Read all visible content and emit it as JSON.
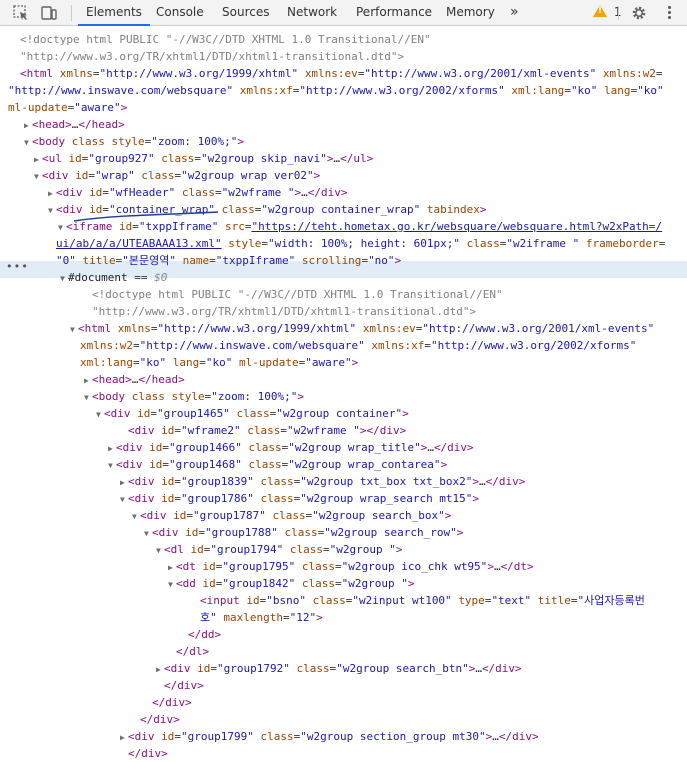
{
  "toolbar": {
    "tabs": [
      "Elements",
      "Console",
      "Sources",
      "Network",
      "Performance",
      "Memory"
    ],
    "active_tab": "Elements",
    "overflow": "»",
    "warning_count": "1"
  },
  "colors": {
    "accent": "#1a73e8",
    "tag": "#881280",
    "attr_name": "#994500",
    "attr_value": "#1a1aa6",
    "selected": "#e1ecf7"
  },
  "lines": [
    {
      "ind": 20,
      "tri": "",
      "segs": [
        [
          "cm",
          "<!doctype html PUBLIC \"-//W3C//DTD XHTML 1.0 Transitional//EN\""
        ]
      ]
    },
    {
      "ind": 20,
      "tri": "",
      "segs": [
        [
          "cm",
          "\"http://www.w3.org/TR/xhtml1/DTD/xhtml1-transitional.dtd\">"
        ]
      ]
    },
    {
      "ind": 20,
      "tri": "",
      "segs": [
        [
          "tag",
          "<html "
        ],
        [
          "an",
          "xmlns"
        ],
        [
          "eq",
          "="
        ],
        [
          "av",
          "\"http://www.w3.org/1999/xhtml\" "
        ],
        [
          "an",
          "xmlns:ev"
        ],
        [
          "eq",
          "="
        ],
        [
          "av",
          "\"http://www.w3.org/2001/xml-events\" "
        ],
        [
          "an",
          "xmlns:w2"
        ],
        [
          "eq",
          "="
        ]
      ]
    },
    {
      "ind": 8,
      "tri": "",
      "segs": [
        [
          "av",
          "\"http://www.inswave.com/websquare\" "
        ],
        [
          "an",
          "xmlns:xf"
        ],
        [
          "eq",
          "="
        ],
        [
          "av",
          "\"http://www.w3.org/2002/xforms\" "
        ],
        [
          "an",
          "xml:lang"
        ],
        [
          "eq",
          "="
        ],
        [
          "av",
          "\"ko\" "
        ],
        [
          "an",
          "lang"
        ],
        [
          "eq",
          "="
        ],
        [
          "av",
          "\"ko\""
        ]
      ]
    },
    {
      "ind": 8,
      "tri": "",
      "segs": [
        [
          "an",
          "ml-update"
        ],
        [
          "eq",
          "="
        ],
        [
          "av",
          "\"aware\""
        ],
        [
          "tag",
          ">"
        ]
      ]
    },
    {
      "ind": 34,
      "tri": "▶",
      "segs": [
        [
          "tag",
          "<head>"
        ],
        [
          "tx",
          "…"
        ],
        [
          "tag",
          "</head>"
        ]
      ]
    },
    {
      "ind": 34,
      "tri": "▼",
      "segs": [
        [
          "tag",
          "<body "
        ],
        [
          "an",
          "class "
        ],
        [
          "an",
          "style"
        ],
        [
          "eq",
          "="
        ],
        [
          "av",
          "\"zoom: 100%;\""
        ],
        [
          "tag",
          ">"
        ]
      ]
    },
    {
      "ind": 44,
      "tri": "▶",
      "segs": [
        [
          "tag",
          "<ul "
        ],
        [
          "an",
          "id"
        ],
        [
          "eq",
          "="
        ],
        [
          "av",
          "\"group927\" "
        ],
        [
          "an",
          "class"
        ],
        [
          "eq",
          "="
        ],
        [
          "av",
          "\"w2group skip_navi\""
        ],
        [
          "tag",
          ">"
        ],
        [
          "tx",
          "…"
        ],
        [
          "tag",
          "</ul>"
        ]
      ]
    },
    {
      "ind": 44,
      "tri": "▼",
      "segs": [
        [
          "tag",
          "<div "
        ],
        [
          "an",
          "id"
        ],
        [
          "eq",
          "="
        ],
        [
          "av",
          "\"wrap\" "
        ],
        [
          "an",
          "class"
        ],
        [
          "eq",
          "="
        ],
        [
          "av",
          "\"w2group wrap ver02\""
        ],
        [
          "tag",
          ">"
        ]
      ]
    },
    {
      "ind": 58,
      "tri": "▶",
      "segs": [
        [
          "tag",
          "<div "
        ],
        [
          "an",
          "id"
        ],
        [
          "eq",
          "="
        ],
        [
          "av",
          "\"wfHeader\" "
        ],
        [
          "an",
          "class"
        ],
        [
          "eq",
          "="
        ],
        [
          "av",
          "\"w2wframe \""
        ],
        [
          "tag",
          ">"
        ],
        [
          "tx",
          "…"
        ],
        [
          "tag",
          "</div>"
        ]
      ]
    },
    {
      "ind": 58,
      "tri": "▼",
      "segs": [
        [
          "tag",
          "<div "
        ],
        [
          "an",
          "id"
        ],
        [
          "eq",
          "="
        ],
        [
          "av",
          "\"container_wrap\" "
        ],
        [
          "an",
          "class"
        ],
        [
          "eq",
          "="
        ],
        [
          "av",
          "\"w2group container_wrap\" "
        ],
        [
          "an",
          "tabindex"
        ],
        [
          "tag",
          ">"
        ]
      ]
    },
    {
      "ind": 68,
      "tri": "▼",
      "segs": [
        [
          "tag",
          "<iframe "
        ],
        [
          "an",
          "id"
        ],
        [
          "eq",
          "="
        ],
        [
          "av",
          "\"txppIframe\" "
        ],
        [
          "an",
          "src"
        ],
        [
          "eq",
          "="
        ],
        [
          "ln",
          "\"https://teht.hometax.go.kr/websquare/websquare.html?w2xPath=/"
        ]
      ]
    },
    {
      "ind": 56,
      "tri": "",
      "segs": [
        [
          "ln",
          "ui/ab/a/a/UTEABAAA13.xml\""
        ],
        [
          "tx",
          " "
        ],
        [
          "an",
          "style"
        ],
        [
          "eq",
          "="
        ],
        [
          "av",
          "\"width: 100%; height: 601px;\" "
        ],
        [
          "an",
          "class"
        ],
        [
          "eq",
          "="
        ],
        [
          "av",
          "\"w2iframe \" "
        ],
        [
          "an",
          "frameborder"
        ],
        [
          "eq",
          "="
        ]
      ]
    },
    {
      "ind": 56,
      "tri": "",
      "segs": [
        [
          "av",
          "\"0\" "
        ],
        [
          "an",
          "title"
        ],
        [
          "eq",
          "="
        ],
        [
          "av",
          "\"본문영역\" "
        ],
        [
          "an",
          "name"
        ],
        [
          "eq",
          "="
        ],
        [
          "av",
          "\"txppIframe\" "
        ],
        [
          "an",
          "scrolling"
        ],
        [
          "eq",
          "="
        ],
        [
          "av",
          "\"no\""
        ],
        [
          "tag",
          ">"
        ]
      ]
    },
    {
      "ind": 70,
      "tri": "▼",
      "segs": [
        [
          "doc",
          "#document"
        ],
        [
          "eq",
          " == "
        ],
        [
          "dollar",
          "$0"
        ]
      ]
    },
    {
      "ind": 92,
      "tri": "",
      "segs": [
        [
          "cm",
          "<!doctype html PUBLIC \"-//W3C//DTD XHTML 1.0 Transitional//EN\""
        ]
      ]
    },
    {
      "ind": 92,
      "tri": "",
      "segs": [
        [
          "cm",
          "\"http://www.w3.org/TR/xhtml1/DTD/xhtml1-transitional.dtd\">"
        ]
      ]
    },
    {
      "ind": 80,
      "tri": "▼",
      "segs": [
        [
          "tag",
          "<html "
        ],
        [
          "an",
          "xmlns"
        ],
        [
          "eq",
          "="
        ],
        [
          "av",
          "\"http://www.w3.org/1999/xhtml\" "
        ],
        [
          "an",
          "xmlns:ev"
        ],
        [
          "eq",
          "="
        ],
        [
          "av",
          "\"http://www.w3.org/2001/xml-events\""
        ]
      ]
    },
    {
      "ind": 80,
      "tri": "",
      "segs": [
        [
          "an",
          "xmlns:w2"
        ],
        [
          "eq",
          "="
        ],
        [
          "av",
          "\"http://www.inswave.com/websquare\" "
        ],
        [
          "an",
          "xmlns:xf"
        ],
        [
          "eq",
          "="
        ],
        [
          "av",
          "\"http://www.w3.org/2002/xforms\""
        ]
      ]
    },
    {
      "ind": 80,
      "tri": "",
      "segs": [
        [
          "an",
          "xml:lang"
        ],
        [
          "eq",
          "="
        ],
        [
          "av",
          "\"ko\" "
        ],
        [
          "an",
          "lang"
        ],
        [
          "eq",
          "="
        ],
        [
          "av",
          "\"ko\" "
        ],
        [
          "an",
          "ml-update"
        ],
        [
          "eq",
          "="
        ],
        [
          "av",
          "\"aware\""
        ],
        [
          "tag",
          ">"
        ]
      ]
    },
    {
      "ind": 94,
      "tri": "▶",
      "segs": [
        [
          "tag",
          "<head>"
        ],
        [
          "tx",
          "…"
        ],
        [
          "tag",
          "</head>"
        ]
      ]
    },
    {
      "ind": 94,
      "tri": "▼",
      "segs": [
        [
          "tag",
          "<body "
        ],
        [
          "an",
          "class "
        ],
        [
          "an",
          "style"
        ],
        [
          "eq",
          "="
        ],
        [
          "av",
          "\"zoom: 100%;\""
        ],
        [
          "tag",
          ">"
        ]
      ]
    },
    {
      "ind": 106,
      "tri": "▼",
      "segs": [
        [
          "tag",
          "<div "
        ],
        [
          "an",
          "id"
        ],
        [
          "eq",
          "="
        ],
        [
          "av",
          "\"group1465\" "
        ],
        [
          "an",
          "class"
        ],
        [
          "eq",
          "="
        ],
        [
          "av",
          "\"w2group container\""
        ],
        [
          "tag",
          ">"
        ]
      ]
    },
    {
      "ind": 128,
      "tri": "",
      "segs": [
        [
          "tag",
          "<div "
        ],
        [
          "an",
          "id"
        ],
        [
          "eq",
          "="
        ],
        [
          "av",
          "\"wframe2\" "
        ],
        [
          "an",
          "class"
        ],
        [
          "eq",
          "="
        ],
        [
          "av",
          "\"w2wframe \""
        ],
        [
          "tag",
          "></div>"
        ]
      ]
    },
    {
      "ind": 118,
      "tri": "▶",
      "segs": [
        [
          "tag",
          "<div "
        ],
        [
          "an",
          "id"
        ],
        [
          "eq",
          "="
        ],
        [
          "av",
          "\"group1466\" "
        ],
        [
          "an",
          "class"
        ],
        [
          "eq",
          "="
        ],
        [
          "av",
          "\"w2group wrap_title\""
        ],
        [
          "tag",
          ">"
        ],
        [
          "tx",
          "…"
        ],
        [
          "tag",
          "</div>"
        ]
      ]
    },
    {
      "ind": 118,
      "tri": "▼",
      "segs": [
        [
          "tag",
          "<div "
        ],
        [
          "an",
          "id"
        ],
        [
          "eq",
          "="
        ],
        [
          "av",
          "\"group1468\" "
        ],
        [
          "an",
          "class"
        ],
        [
          "eq",
          "="
        ],
        [
          "av",
          "\"w2group wrap_contarea\""
        ],
        [
          "tag",
          ">"
        ]
      ]
    },
    {
      "ind": 130,
      "tri": "▶",
      "segs": [
        [
          "tag",
          "<div "
        ],
        [
          "an",
          "id"
        ],
        [
          "eq",
          "="
        ],
        [
          "av",
          "\"group1839\" "
        ],
        [
          "an",
          "class"
        ],
        [
          "eq",
          "="
        ],
        [
          "av",
          "\"w2group txt_box txt_box2\""
        ],
        [
          "tag",
          ">"
        ],
        [
          "tx",
          "…"
        ],
        [
          "tag",
          "</div>"
        ]
      ]
    },
    {
      "ind": 130,
      "tri": "▼",
      "segs": [
        [
          "tag",
          "<div "
        ],
        [
          "an",
          "id"
        ],
        [
          "eq",
          "="
        ],
        [
          "av",
          "\"group1786\" "
        ],
        [
          "an",
          "class"
        ],
        [
          "eq",
          "="
        ],
        [
          "av",
          "\"w2group wrap_search mt15\""
        ],
        [
          "tag",
          ">"
        ]
      ]
    },
    {
      "ind": 142,
      "tri": "▼",
      "segs": [
        [
          "tag",
          "<div "
        ],
        [
          "an",
          "id"
        ],
        [
          "eq",
          "="
        ],
        [
          "av",
          "\"group1787\" "
        ],
        [
          "an",
          "class"
        ],
        [
          "eq",
          "="
        ],
        [
          "av",
          "\"w2group search_box\""
        ],
        [
          "tag",
          ">"
        ]
      ]
    },
    {
      "ind": 154,
      "tri": "▼",
      "segs": [
        [
          "tag",
          "<div "
        ],
        [
          "an",
          "id"
        ],
        [
          "eq",
          "="
        ],
        [
          "av",
          "\"group1788\" "
        ],
        [
          "an",
          "class"
        ],
        [
          "eq",
          "="
        ],
        [
          "av",
          "\"w2group search_row\""
        ],
        [
          "tag",
          ">"
        ]
      ]
    },
    {
      "ind": 166,
      "tri": "▼",
      "segs": [
        [
          "tag",
          "<dl "
        ],
        [
          "an",
          "id"
        ],
        [
          "eq",
          "="
        ],
        [
          "av",
          "\"group1794\" "
        ],
        [
          "an",
          "class"
        ],
        [
          "eq",
          "="
        ],
        [
          "av",
          "\"w2group \""
        ],
        [
          "tag",
          ">"
        ]
      ]
    },
    {
      "ind": 178,
      "tri": "▶",
      "segs": [
        [
          "tag",
          "<dt "
        ],
        [
          "an",
          "id"
        ],
        [
          "eq",
          "="
        ],
        [
          "av",
          "\"group1795\" "
        ],
        [
          "an",
          "class"
        ],
        [
          "eq",
          "="
        ],
        [
          "av",
          "\"w2group ico_chk wt95\""
        ],
        [
          "tag",
          ">"
        ],
        [
          "tx",
          "…"
        ],
        [
          "tag",
          "</dt>"
        ]
      ]
    },
    {
      "ind": 178,
      "tri": "▼",
      "segs": [
        [
          "tag",
          "<dd "
        ],
        [
          "an",
          "id"
        ],
        [
          "eq",
          "="
        ],
        [
          "av",
          "\"group1842\" "
        ],
        [
          "an",
          "class"
        ],
        [
          "eq",
          "="
        ],
        [
          "av",
          "\"w2group \""
        ],
        [
          "tag",
          ">"
        ]
      ]
    },
    {
      "ind": 200,
      "tri": "",
      "segs": [
        [
          "tag",
          "<input "
        ],
        [
          "an",
          "id"
        ],
        [
          "eq",
          "="
        ],
        [
          "av",
          "\"bsno\" "
        ],
        [
          "an",
          "class"
        ],
        [
          "eq",
          "="
        ],
        [
          "av",
          "\"w2input wt100\" "
        ],
        [
          "an",
          "type"
        ],
        [
          "eq",
          "="
        ],
        [
          "av",
          "\"text\" "
        ],
        [
          "an",
          "title"
        ],
        [
          "eq",
          "="
        ],
        [
          "av",
          "\"사업자등록번"
        ]
      ]
    },
    {
      "ind": 200,
      "tri": "",
      "segs": [
        [
          "av",
          "호\" "
        ],
        [
          "an",
          "maxlength"
        ],
        [
          "eq",
          "="
        ],
        [
          "av",
          "\"12\""
        ],
        [
          "tag",
          ">"
        ]
      ]
    },
    {
      "ind": 188,
      "tri": "",
      "segs": [
        [
          "tag",
          "</dd>"
        ]
      ]
    },
    {
      "ind": 176,
      "tri": "",
      "segs": [
        [
          "tag",
          "</dl>"
        ]
      ]
    },
    {
      "ind": 166,
      "tri": "▶",
      "segs": [
        [
          "tag",
          "<div "
        ],
        [
          "an",
          "id"
        ],
        [
          "eq",
          "="
        ],
        [
          "av",
          "\"group1792\" "
        ],
        [
          "an",
          "class"
        ],
        [
          "eq",
          "="
        ],
        [
          "av",
          "\"w2group search_btn\""
        ],
        [
          "tag",
          ">"
        ],
        [
          "tx",
          "…"
        ],
        [
          "tag",
          "</div>"
        ]
      ]
    },
    {
      "ind": 164,
      "tri": "",
      "segs": [
        [
          "tag",
          "</div>"
        ]
      ]
    },
    {
      "ind": 152,
      "tri": "",
      "segs": [
        [
          "tag",
          "</div>"
        ]
      ]
    },
    {
      "ind": 140,
      "tri": "",
      "segs": [
        [
          "tag",
          "</div>"
        ]
      ]
    },
    {
      "ind": 130,
      "tri": "▶",
      "segs": [
        [
          "tag",
          "<div "
        ],
        [
          "an",
          "id"
        ],
        [
          "eq",
          "="
        ],
        [
          "av",
          "\"group1799\" "
        ],
        [
          "an",
          "class"
        ],
        [
          "eq",
          "="
        ],
        [
          "av",
          "\"w2group section_group mt30\""
        ],
        [
          "tag",
          ">"
        ],
        [
          "tx",
          "…"
        ],
        [
          "tag",
          "</div>"
        ]
      ]
    },
    {
      "ind": 128,
      "tri": "",
      "segs": [
        [
          "tag",
          "</div>"
        ]
      ]
    }
  ]
}
